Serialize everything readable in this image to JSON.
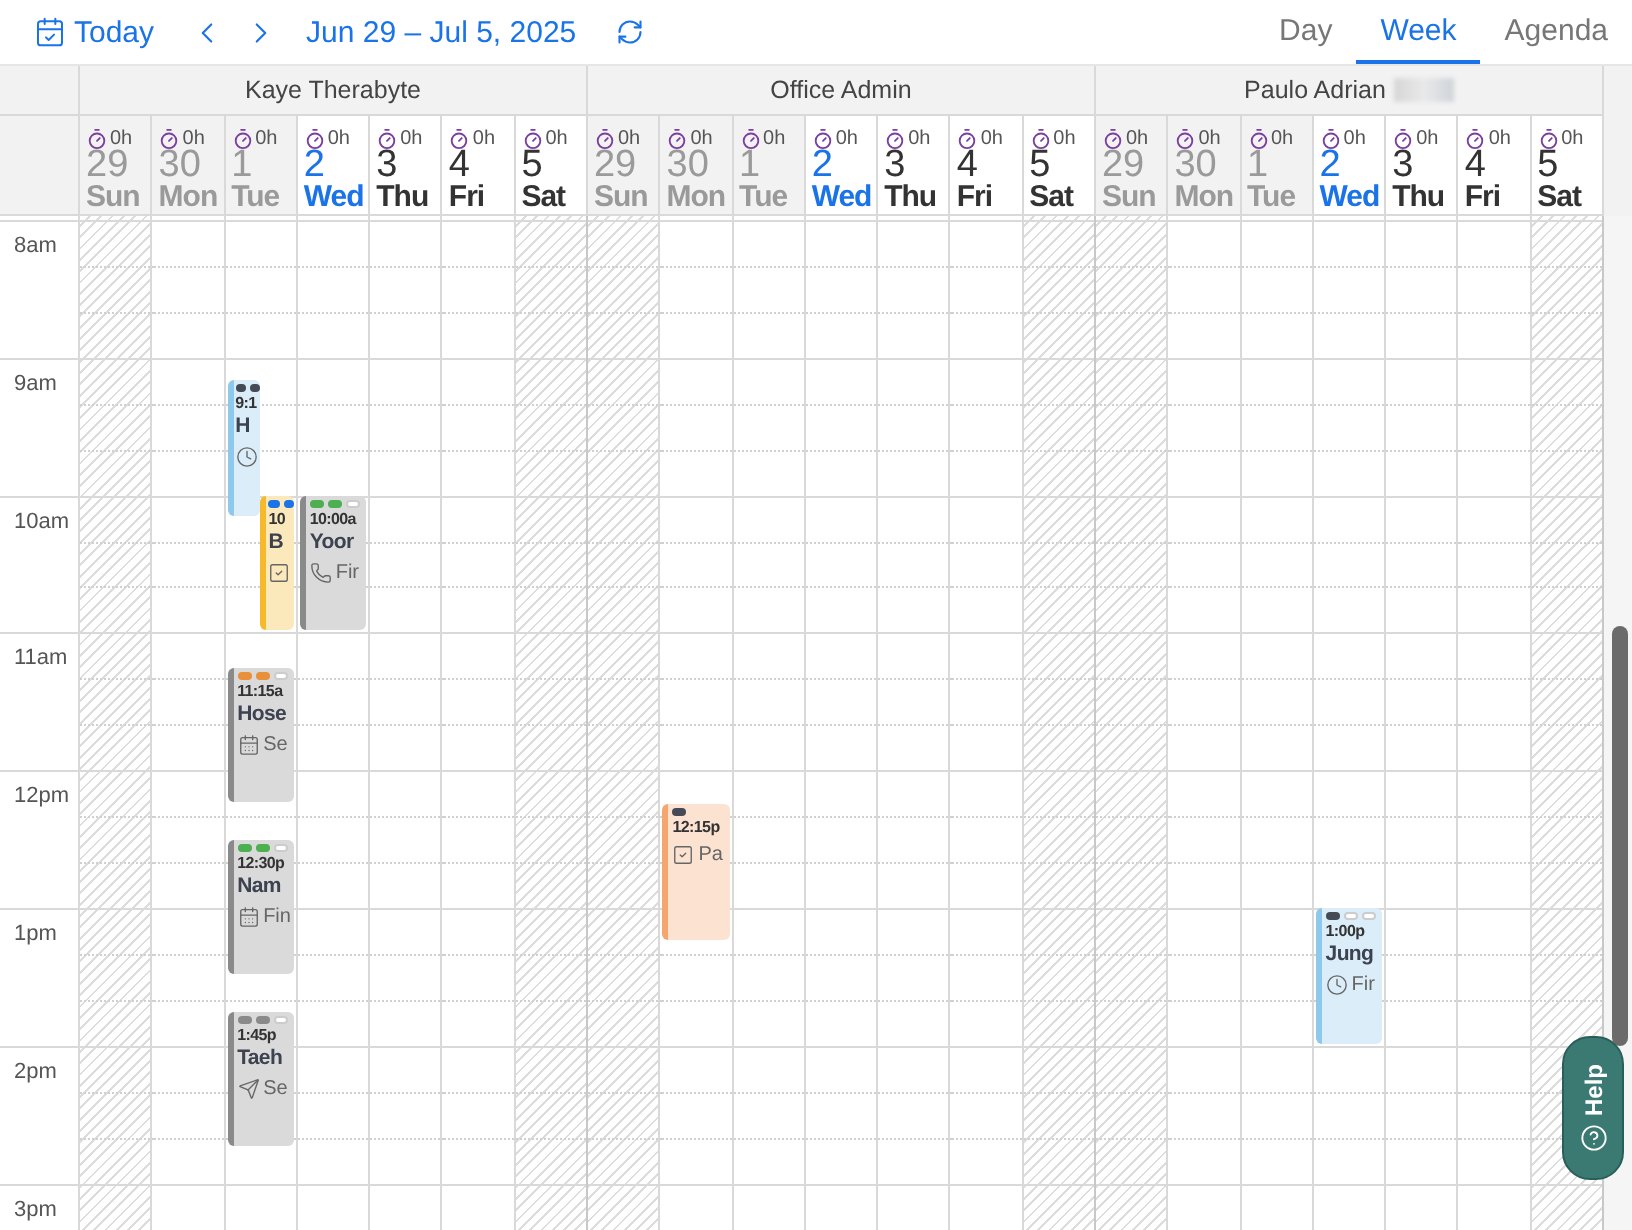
{
  "toolbar": {
    "today": "Today",
    "range": "Jun 29 – Jul 5, 2025"
  },
  "views": [
    {
      "label": "Day",
      "selected": false
    },
    {
      "label": "Week",
      "selected": true
    },
    {
      "label": "Agenda",
      "selected": false
    }
  ],
  "times": [
    "8am",
    "9am",
    "10am",
    "11am",
    "12pm",
    "1pm",
    "2pm",
    "3pm"
  ],
  "staff": [
    {
      "name": "Kaye Therabyte",
      "blurred": false,
      "days": [
        {
          "hours": "0h",
          "date": "29",
          "weekday": "Sun",
          "past": true,
          "today": false,
          "weekend": true
        },
        {
          "hours": "0h",
          "date": "30",
          "weekday": "Mon",
          "past": true,
          "today": false,
          "weekend": false
        },
        {
          "hours": "0h",
          "date": "1",
          "weekday": "Tue",
          "past": true,
          "today": false,
          "weekend": false,
          "events": [
            {
              "time": "9:1",
              "title": "H",
              "kind": "timed",
              "narrow": true,
              "color": "#8ec8ea",
              "markers": [
                {
                  "filled": true,
                  "color": "#444b57"
                },
                {
                  "filled": true,
                  "color": "#444b57"
                }
              ]
            },
            {
              "time": "10",
              "title": "B",
              "kind": "task",
              "narrow": true,
              "color": "#f6b92b",
              "markers": [
                {
                  "filled": true,
                  "color": "#1a73e8"
                },
                {
                  "filled": true,
                  "color": "#1a73e8"
                }
              ]
            },
            {
              "time": "11:15a",
              "title": "Hose",
              "subtitle": "Se",
              "kind": "meeting",
              "narrow": false,
              "color": "#8a8a8a",
              "markers": [
                {
                  "filled": true,
                  "color": "#e8913a"
                },
                {
                  "filled": true,
                  "color": "#e8913a"
                },
                {
                  "filled": false
                }
              ]
            },
            {
              "time": "12:30p",
              "title": "Nam",
              "subtitle": "Fin",
              "kind": "meeting",
              "narrow": false,
              "color": "#8a8a8a",
              "markers": [
                {
                  "filled": true,
                  "color": "#4caf50"
                },
                {
                  "filled": true,
                  "color": "#4caf50"
                },
                {
                  "filled": false
                }
              ]
            },
            {
              "time": "1:45p",
              "title": "Taeh",
              "subtitle": "Se",
              "kind": "message",
              "narrow": false,
              "color": "#8a8a8a",
              "markers": [
                {
                  "filled": true,
                  "color": "#8a8a8a"
                },
                {
                  "filled": true,
                  "color": "#8a8a8a"
                },
                {
                  "filled": false
                }
              ]
            }
          ]
        },
        {
          "hours": "0h",
          "date": "2",
          "weekday": "Wed",
          "past": false,
          "today": true,
          "weekend": false,
          "events": [
            {
              "time": "10:00a",
              "title": "Yoor",
              "subtitle": "Fir",
              "kind": "call",
              "narrow": false,
              "color": "#8a8a8a",
              "markers": [
                {
                  "filled": true,
                  "color": "#4caf50"
                },
                {
                  "filled": true,
                  "color": "#4caf50"
                },
                {
                  "filled": false
                }
              ]
            }
          ]
        },
        {
          "hours": "0h",
          "date": "3",
          "weekday": "Thu",
          "past": false,
          "today": false,
          "weekend": false
        },
        {
          "hours": "0h",
          "date": "4",
          "weekday": "Fri",
          "past": false,
          "today": false,
          "weekend": false
        },
        {
          "hours": "0h",
          "date": "5",
          "weekday": "Sat",
          "past": false,
          "today": false,
          "weekend": true
        }
      ]
    },
    {
      "name": "Office Admin",
      "blurred": false,
      "days": [
        {
          "hours": "0h",
          "date": "29",
          "weekday": "Sun",
          "past": true,
          "today": false,
          "weekend": true
        },
        {
          "hours": "0h",
          "date": "30",
          "weekday": "Mon",
          "past": true,
          "today": false,
          "weekend": false,
          "events": [
            {
              "time": "12:15p",
              "subtitle": "Pa",
              "kind": "task",
              "narrow": false,
              "color": "#f5a66f",
              "markers": [
                {
                  "filled": true,
                  "color": "#444b57"
                }
              ]
            }
          ]
        },
        {
          "hours": "0h",
          "date": "1",
          "weekday": "Tue",
          "past": true,
          "today": false,
          "weekend": false
        },
        {
          "hours": "0h",
          "date": "2",
          "weekday": "Wed",
          "past": false,
          "today": true,
          "weekend": false
        },
        {
          "hours": "0h",
          "date": "3",
          "weekday": "Thu",
          "past": false,
          "today": false,
          "weekend": false
        },
        {
          "hours": "0h",
          "date": "4",
          "weekday": "Fri",
          "past": false,
          "today": false,
          "weekend": false
        },
        {
          "hours": "0h",
          "date": "5",
          "weekday": "Sat",
          "past": false,
          "today": false,
          "weekend": true
        }
      ]
    },
    {
      "name": "Paulo Adrian",
      "blurred": true,
      "days": [
        {
          "hours": "0h",
          "date": "29",
          "weekday": "Sun",
          "past": true,
          "today": false,
          "weekend": true
        },
        {
          "hours": "0h",
          "date": "30",
          "weekday": "Mon",
          "past": true,
          "today": false,
          "weekend": false
        },
        {
          "hours": "0h",
          "date": "1",
          "weekday": "Tue",
          "past": true,
          "today": false,
          "weekend": false
        },
        {
          "hours": "0h",
          "date": "2",
          "weekday": "Wed",
          "past": false,
          "today": true,
          "weekend": false,
          "events": [
            {
              "time": "1:00p",
              "title": "Jung",
              "subtitle": "Fir",
              "kind": "timed",
              "narrow": false,
              "color": "#8ec8ea",
              "markers": [
                {
                  "filled": true,
                  "color": "#444b57"
                },
                {
                  "filled": false
                },
                {
                  "filled": false
                }
              ]
            }
          ]
        },
        {
          "hours": "0h",
          "date": "3",
          "weekday": "Thu",
          "past": false,
          "today": false,
          "weekend": false
        },
        {
          "hours": "0h",
          "date": "4",
          "weekday": "Fri",
          "past": false,
          "today": false,
          "weekend": false
        },
        {
          "hours": "0h",
          "date": "5",
          "weekday": "Sat",
          "past": false,
          "today": false,
          "weekend": true
        }
      ]
    }
  ],
  "help": "Help"
}
